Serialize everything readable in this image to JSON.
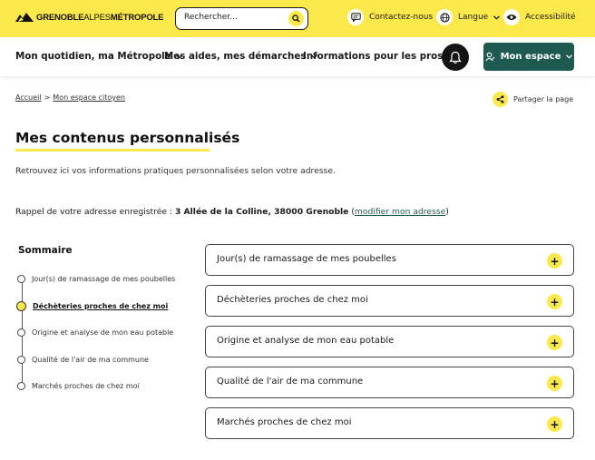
{
  "header": {
    "logo_bold": "GRENOBLE",
    "logo_thin": "ALPES",
    "logo_end": "MÉTROPOLE",
    "search_placeholder": "Rechercher...",
    "contact": "Contactez-nous",
    "language": "Langue",
    "accessibility": "Accessibilité"
  },
  "nav": {
    "items": [
      "Mon quotidien, ma Métropole",
      "Mes aides, mes démarches",
      "Informations pour les pros"
    ],
    "account": "Mon espace"
  },
  "breadcrumb": [
    "Accueil",
    "Mon espace citoyen"
  ],
  "breadcrumb_sep": ">",
  "share": "Partager la page",
  "page": {
    "title": "Mes contenus personnalisés",
    "intro": "Retrouvez ici vos informations pratiques personnalisées selon votre adresse.",
    "addr_prefix": "Rappel de votre adresse enregistrée : ",
    "addr_value": "3 Allée de la Colline, 38000 Grenoble",
    "addr_open": " (",
    "addr_link": "modifier mon adresse",
    "addr_close": ")"
  },
  "sommaire": {
    "title": "Sommaire",
    "items": [
      "Jour(s) de ramassage de mes poubelles",
      "Déchèteries proches de chez moi",
      "Origine et analyse de mon eau potable",
      "Qualité de l'air de ma commune",
      "Marchés proches de chez moi"
    ],
    "active_index": 1
  },
  "accordion": [
    "Jour(s) de ramassage de mes poubelles",
    "Déchèteries proches de chez moi",
    "Origine et analyse de mon eau potable",
    "Qualité de l'air de ma commune",
    "Marchés proches de chez moi"
  ],
  "plus_symbol": "+",
  "colors": {
    "brand_yellow": "#fbe84a",
    "account_green": "#1f5a51"
  }
}
